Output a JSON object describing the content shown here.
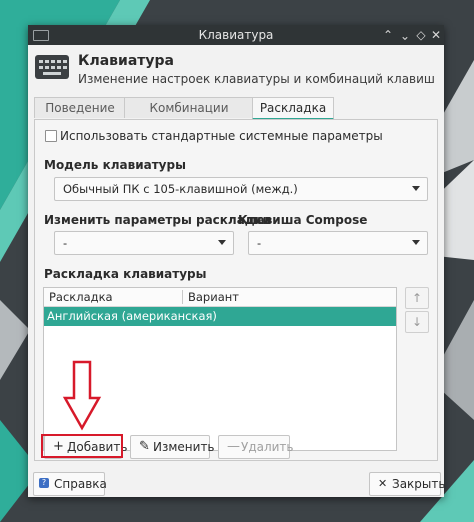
{
  "window": {
    "title": "Клавиатура",
    "controls": {
      "shade": "⌃",
      "maximize": "⌃",
      "restore": "◇",
      "close": "✕"
    }
  },
  "header": {
    "title": "Клавиатура",
    "subtitle": "Изменение настроек клавиатуры и комбинаций клавиш",
    "icon": "keyboard-icon"
  },
  "tabs": [
    {
      "label": "Поведение",
      "active": false
    },
    {
      "label": "Комбинации клавиш",
      "active": false
    },
    {
      "label": "Раскладка",
      "active": true
    }
  ],
  "layout_tab": {
    "use_system_defaults": {
      "label": "Использовать стандартные системные параметры",
      "checked": false
    },
    "keyboard_model": {
      "label": "Модель клавиатуры",
      "value": "Обычный ПК с 105-клавишной (межд.)"
    },
    "change_layout_options": {
      "label": "Изменить параметры раскладки",
      "value": "-"
    },
    "compose_key": {
      "label": "Клавиша Compose",
      "value": "-"
    },
    "layouts": {
      "label": "Раскладка клавиатуры",
      "columns": [
        "Раскладка",
        "Вариант"
      ],
      "rows": [
        {
          "layout": "Английская (американская)",
          "variant": "",
          "selected": true
        }
      ],
      "move_up": "↑",
      "move_down": "↓"
    },
    "buttons": {
      "add": "Добавить",
      "add_icon": "+",
      "edit": "Изменить",
      "edit_icon": "✎",
      "remove": "Удалить",
      "remove_icon": "—"
    }
  },
  "footer": {
    "help": "Справка",
    "close": "Закрыть",
    "close_icon": "✕"
  },
  "colors": {
    "accent": "#2fa794",
    "highlight": "#d7192a",
    "titlebar": "#2f3436"
  }
}
